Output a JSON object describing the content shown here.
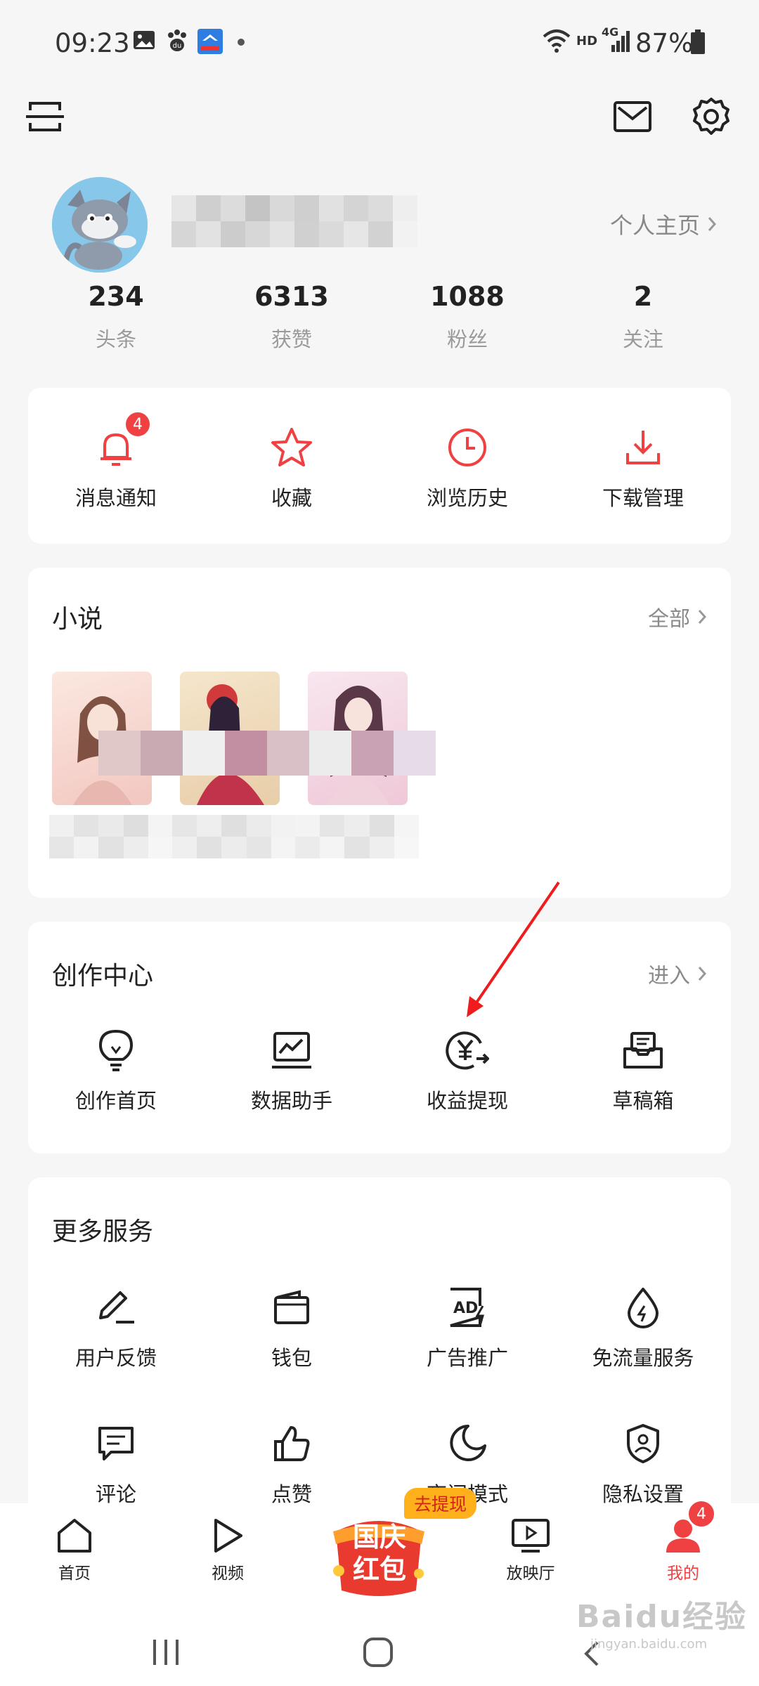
{
  "status_bar": {
    "time": "09:23",
    "network": "HD",
    "cell": "4G",
    "battery": "87%"
  },
  "top_bar": {
    "left_icon": "scan-icon",
    "right_icons": [
      "mail-icon",
      "settings-gear-icon"
    ]
  },
  "profile": {
    "home_link": "个人主页",
    "stats": [
      {
        "value": "234",
        "label": "头条"
      },
      {
        "value": "6313",
        "label": "获赞"
      },
      {
        "value": "1088",
        "label": "粉丝"
      },
      {
        "value": "2",
        "label": "关注"
      }
    ]
  },
  "quick_actions": [
    {
      "label": "消息通知",
      "icon": "bell-icon",
      "badge": "4"
    },
    {
      "label": "收藏",
      "icon": "star-icon"
    },
    {
      "label": "浏览历史",
      "icon": "clock-icon"
    },
    {
      "label": "下载管理",
      "icon": "download-icon"
    }
  ],
  "novels": {
    "title": "小说",
    "more": "全部"
  },
  "creator": {
    "title": "创作中心",
    "more": "进入",
    "items": [
      {
        "label": "创作首页",
        "icon": "lightbulb-icon"
      },
      {
        "label": "数据助手",
        "icon": "chart-monitor-icon"
      },
      {
        "label": "收益提现",
        "icon": "yen-withdraw-icon"
      },
      {
        "label": "草稿箱",
        "icon": "draft-box-icon"
      }
    ]
  },
  "services": {
    "title": "更多服务",
    "row1": [
      {
        "label": "用户反馈",
        "icon": "pen-feedback-icon"
      },
      {
        "label": "钱包",
        "icon": "wallet-icon"
      },
      {
        "label": "广告推广",
        "icon": "ad-icon"
      },
      {
        "label": "免流量服务",
        "icon": "drop-icon"
      }
    ],
    "row2": [
      {
        "label": "评论",
        "icon": "comment-icon"
      },
      {
        "label": "点赞",
        "icon": "thumbs-up-icon"
      },
      {
        "label": "夜间模式",
        "icon": "moon-icon"
      },
      {
        "label": "隐私设置",
        "icon": "shield-user-icon"
      }
    ]
  },
  "promo": {
    "tag": "去提现",
    "line1": "国庆",
    "line2": "红包"
  },
  "bottom_nav": [
    {
      "label": "首页",
      "icon": "home-icon"
    },
    {
      "label": "视频",
      "icon": "play-icon"
    },
    {
      "label": "放映厅",
      "icon": "tv-play-icon"
    },
    {
      "label": "我的",
      "icon": "user-icon",
      "badge": "4"
    }
  ],
  "watermark": {
    "text": "Baidu经验",
    "sub": "jingyan.baidu.com"
  },
  "colors": {
    "accent": "#f04142",
    "text": "#222222",
    "muted": "#8a8a8a"
  }
}
